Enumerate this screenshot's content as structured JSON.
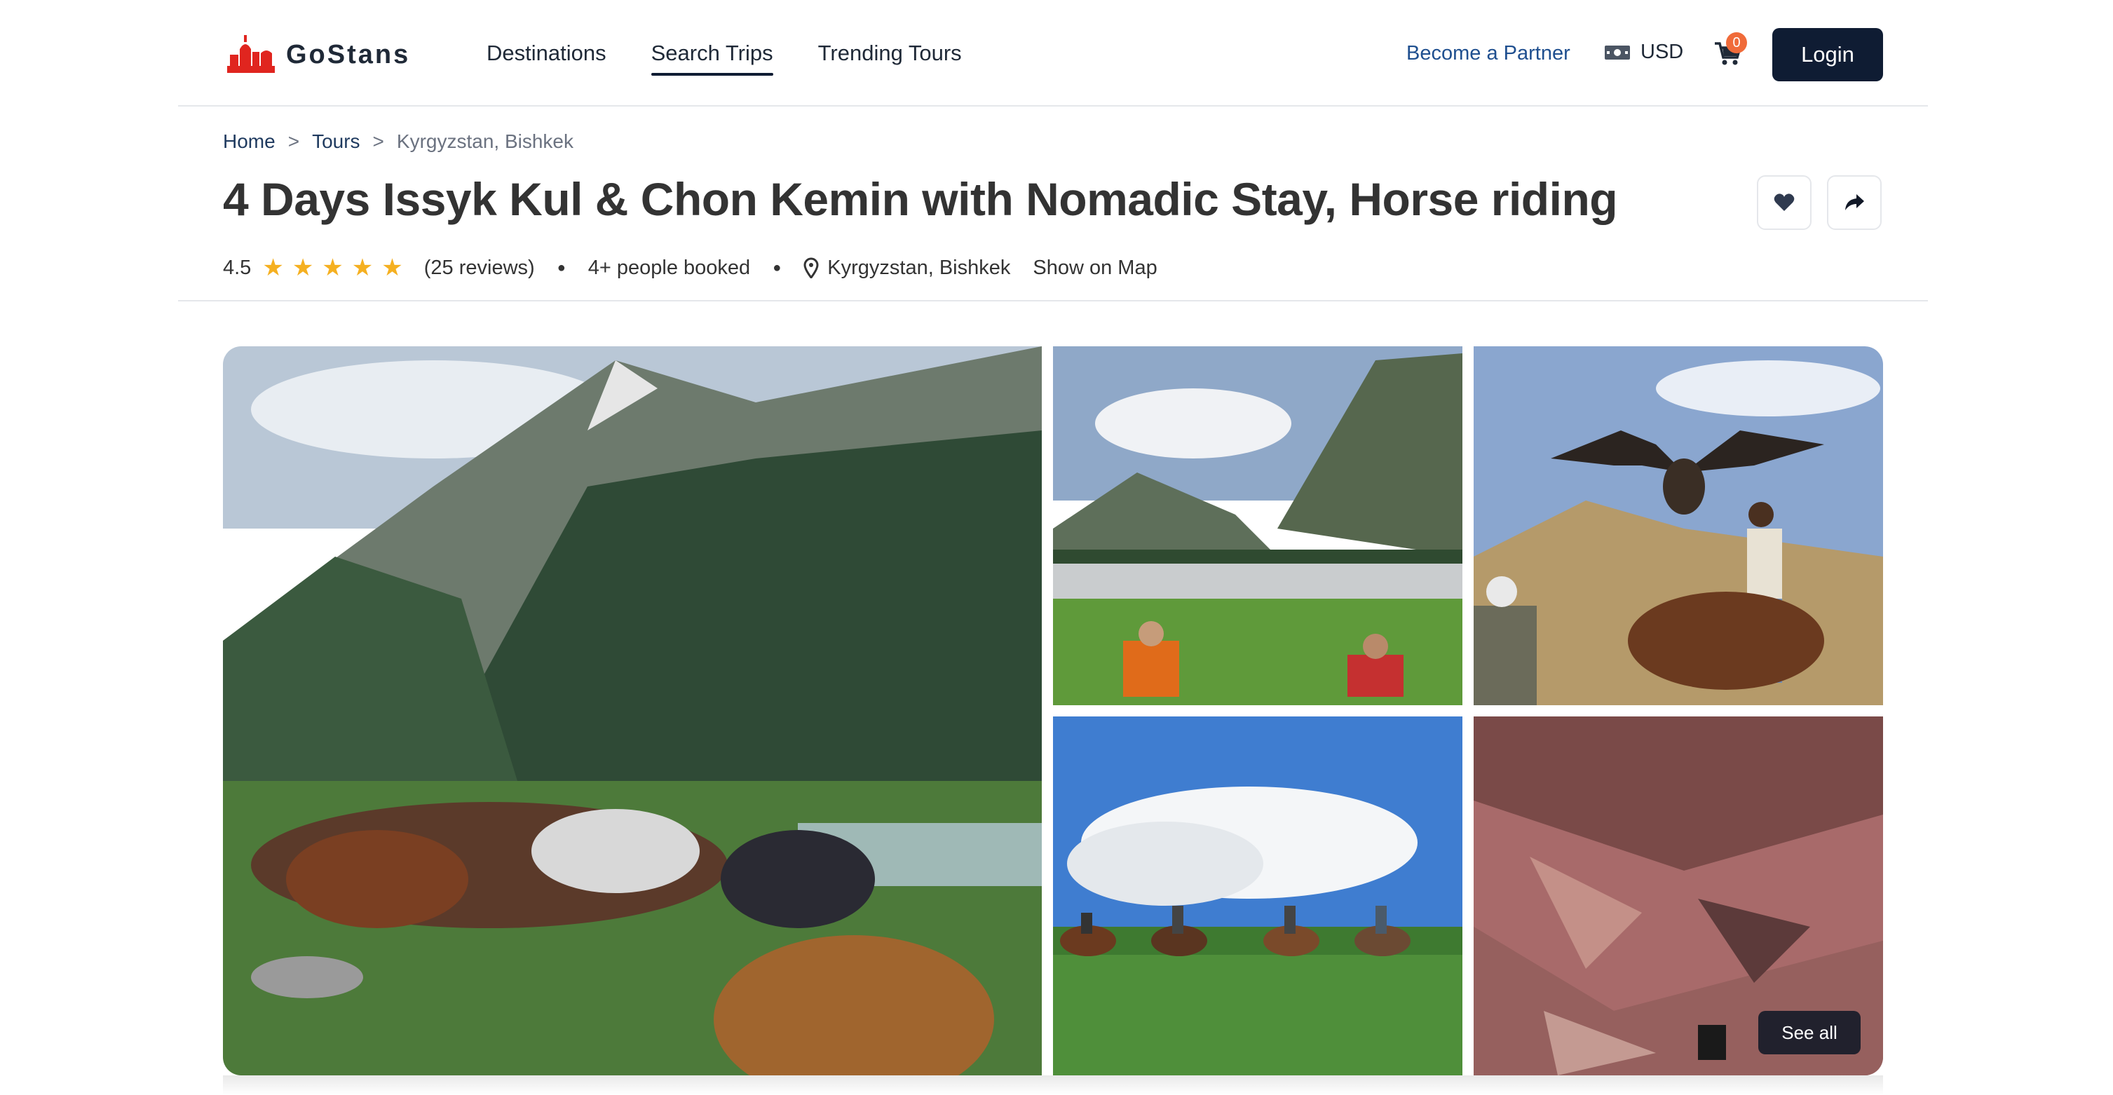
{
  "header": {
    "brand": "GoStans",
    "nav": [
      {
        "label": "Destinations"
      },
      {
        "label": "Search Trips",
        "active": true
      },
      {
        "label": "Trending Tours"
      }
    ],
    "partner_label": "Become a Partner",
    "currency_label": "USD",
    "cart_count": "0",
    "login_label": "Login",
    "icons": [
      "city-logo-icon",
      "banknote-icon",
      "cart-icon"
    ]
  },
  "breadcrumb": {
    "items": [
      "Home",
      "Tours"
    ],
    "separator": ">",
    "current": "Kyrgyzstan, Bishkek"
  },
  "tour": {
    "title": "4 Days Issyk Kul & Chon Kemin with Nomadic Stay, Horse riding",
    "rating": "4.5",
    "stars": 5,
    "reviews_label": "(25 reviews)",
    "booked_label": "4+ people booked",
    "location": "Kyrgyzstan, Bishkek",
    "show_map_label": "Show on Map",
    "actions": [
      "heart-icon",
      "share-icon"
    ]
  },
  "gallery": {
    "see_all_label": "See all",
    "images": [
      "horses-by-river",
      "valley-picnic",
      "eagle-hunter-on-horse",
      "horse-riders-on-hill",
      "red-canyon"
    ]
  },
  "colors": {
    "primary_dark": "#0f1c33",
    "link_blue": "#1f4f8f",
    "star": "#f5b021",
    "logo_red": "#e0251f",
    "badge": "#f06b3a"
  }
}
